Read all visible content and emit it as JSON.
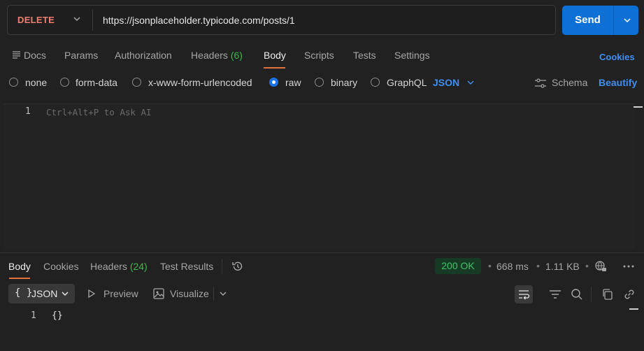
{
  "request": {
    "method": "DELETE",
    "url": "https://jsonplaceholder.typicode.com/posts/1",
    "send_label": "Send"
  },
  "request_tabs": [
    {
      "label": "Docs"
    },
    {
      "label": "Params"
    },
    {
      "label": "Authorization"
    },
    {
      "label": "Headers",
      "count": "(6)"
    },
    {
      "label": "Body",
      "active": true
    },
    {
      "label": "Scripts"
    },
    {
      "label": "Tests"
    },
    {
      "label": "Settings"
    }
  ],
  "cookies_link": "Cookies",
  "body_types": {
    "options": [
      "none",
      "form-data",
      "x-www-form-urlencoded",
      "raw",
      "binary",
      "GraphQL"
    ],
    "selected": "raw",
    "format": "JSON",
    "schema_label": "Schema",
    "beautify_label": "Beautify"
  },
  "editor": {
    "line_number": "1",
    "placeholder": "Ctrl+Alt+P to Ask AI"
  },
  "response_tabs": [
    {
      "label": "Body",
      "active": true
    },
    {
      "label": "Cookies"
    },
    {
      "label": "Headers",
      "count": "(24)"
    },
    {
      "label": "Test Results"
    }
  ],
  "response_meta": {
    "status": "200 OK",
    "time": "668 ms",
    "size": "1.11 KB"
  },
  "response_toolbar": {
    "format_braces": "{ }",
    "format_label": "JSON",
    "preview_label": "Preview",
    "visualize_label": "Visualize"
  },
  "response_body": {
    "line_number": "1",
    "content": "{}"
  },
  "colors": {
    "accent": "#0c70d6",
    "link": "#3f8ef0",
    "method_delete": "#f07f6f",
    "status_ok": "#3fc46a",
    "active_tab_underline": "#e0713b"
  }
}
